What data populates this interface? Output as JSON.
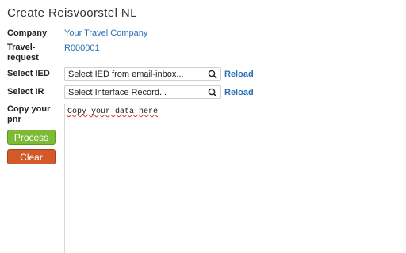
{
  "title": "Create Reisvoorstel NL",
  "company": {
    "label": "Company",
    "value": "Your Travel Company"
  },
  "travel_request": {
    "label_line1": "Travel-",
    "label_line2": "request",
    "value": "R000001"
  },
  "select_ied": {
    "label": "Select IED",
    "placeholder": "Select IED from email-inbox...",
    "reload_label": "Reload"
  },
  "select_ir": {
    "label": "Select IR",
    "placeholder": "Select Interface Record...",
    "reload_label": "Reload"
  },
  "pnr": {
    "label_line1": "Copy your",
    "label_line2": "pnr",
    "text": "Copy your data here"
  },
  "buttons": {
    "process_label": "Process",
    "clear_label": "Clear"
  },
  "colors": {
    "link": "#2a6fb5",
    "process": "#7dba35",
    "clear": "#d25a2a"
  },
  "icons": {
    "search": "search-icon"
  }
}
